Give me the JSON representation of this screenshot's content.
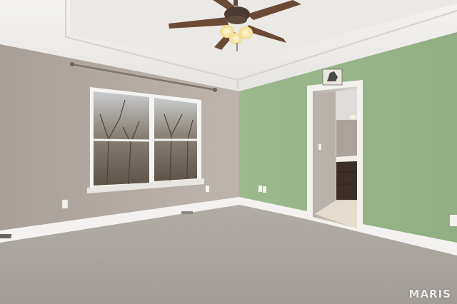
{
  "watermark": {
    "text": "MARIS"
  }
}
